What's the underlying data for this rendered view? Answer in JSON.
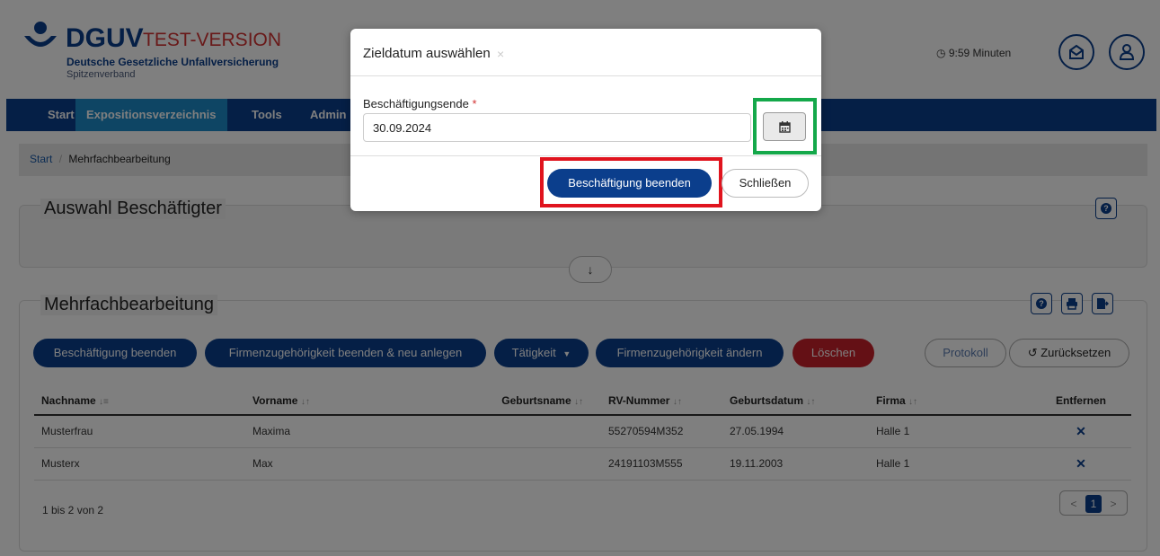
{
  "header": {
    "logo_name": "DGUV",
    "logo_test": "TEST-VERSION",
    "logo_subtitle": "Deutsche Gesetzliche Unfallversicherung",
    "logo_subtitle2": "Spitzenverband",
    "timer": "9:59 Minuten",
    "brand_color": "#0b3e8c"
  },
  "nav": {
    "items": [
      "Start",
      "Expositionsverzeichnis",
      "Tools",
      "Admin"
    ],
    "active_index": 1
  },
  "breadcrumb": {
    "home": "Start",
    "separator": "/",
    "current": "Mehrfachbearbeitung"
  },
  "auswahl": {
    "title": "Auswahl Beschäftigter",
    "help_icon": "question-circle-icon",
    "toggle_icon": "arrow-down-icon"
  },
  "mehrfach": {
    "title": "Mehrfachbearbeitung",
    "buttons": {
      "beenden": "Beschäftigung beenden",
      "firmen_neu": "Firmenzugehörigkeit beenden & neu anlegen",
      "taetigkeit": "Tätigkeit",
      "firmen_aendern": "Firmenzugehörigkeit ändern",
      "loeschen": "Löschen",
      "protokoll": "Protokoll",
      "zuruecksetzen": "Zurücksetzen"
    },
    "columns": [
      "Nachname",
      "Vorname",
      "Geburtsname",
      "RV-Nummer",
      "Geburtsdatum",
      "Firma",
      "Entfernen"
    ],
    "rows": [
      {
        "nachname": "Musterfrau",
        "vorname": "Maxima",
        "geburtsname": "",
        "rv": "55270594M352",
        "geburtsdatum": "27.05.1994",
        "firma": "Halle 1",
        "entfernen": "✕"
      },
      {
        "nachname": "Musterx",
        "vorname": "Max",
        "geburtsname": "",
        "rv": "24191103M555",
        "geburtsdatum": "19.11.2003",
        "firma": "Halle 1",
        "entfernen": "✕"
      }
    ],
    "pager_info": "1 bis 2 von 2",
    "pager": {
      "prev": "<",
      "page": "1",
      "next": ">"
    }
  },
  "modal": {
    "title": "Zieldatum auswählen",
    "close": "×",
    "field_label": "Beschäftigungsende",
    "required_mark": "*",
    "date_value": "30.09.2024",
    "calendar_icon": "calendar-icon",
    "primary_button": "Beschäftigung beenden",
    "close_button": "Schließen",
    "highlight_colors": {
      "calendar": "#14a84a",
      "primary": "#e0141e"
    }
  }
}
